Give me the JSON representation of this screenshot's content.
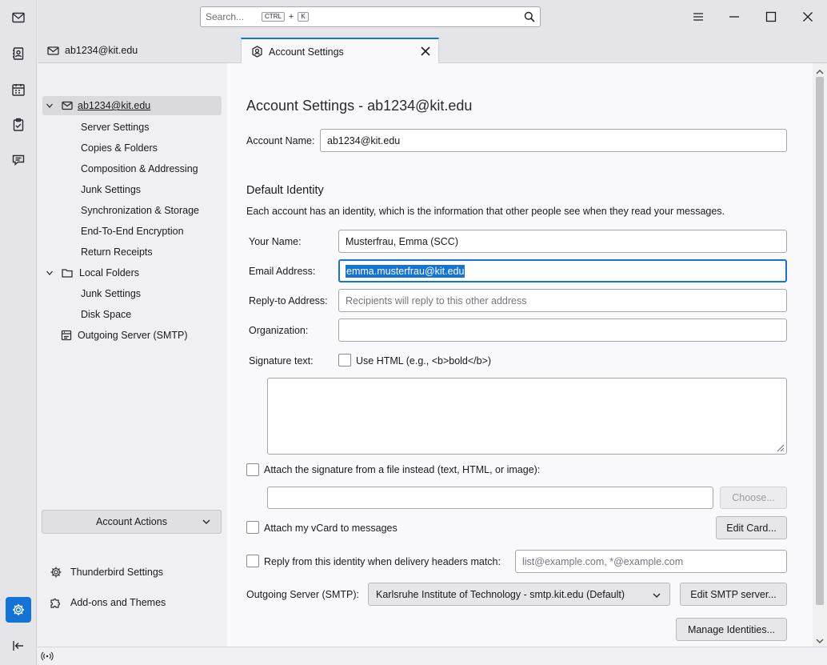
{
  "search": {
    "placeholder": "Search...",
    "shortcut_mod": "CTRL",
    "shortcut_plus": "+",
    "shortcut_key": "K"
  },
  "tabs": [
    {
      "label": "ab1234@kit.edu"
    },
    {
      "label": "Account Settings"
    }
  ],
  "sidebar": {
    "account": "ab1234@kit.edu",
    "account_children": [
      "Server Settings",
      "Copies & Folders",
      "Composition & Addressing",
      "Junk Settings",
      "Synchronization & Storage",
      "End-To-End Encryption",
      "Return Receipts"
    ],
    "local_folders": "Local Folders",
    "local_children": [
      "Junk Settings",
      "Disk Space"
    ],
    "outgoing": "Outgoing Server (SMTP)",
    "account_actions": "Account Actions",
    "thunderbird_settings": "Thunderbird Settings",
    "addons": "Add-ons and Themes"
  },
  "main": {
    "title": "Account Settings - ab1234@kit.edu",
    "account_name_label": "Account Name:",
    "account_name_value": "ab1234@kit.edu",
    "default_identity_heading": "Default Identity",
    "identity_description": "Each account has an identity, which is the information that other people see when they read your messages.",
    "your_name_label": "Your Name:",
    "your_name_value": "Musterfrau, Emma (SCC)",
    "email_label": "Email Address:",
    "email_value": "emma.musterfrau@kit.edu",
    "reply_to_label": "Reply-to Address:",
    "reply_to_placeholder": "Recipients will reply to this other address",
    "organization_label": "Organization:",
    "organization_value": "",
    "signature_label": "Signature text:",
    "use_html_label": "Use HTML (e.g., <b>bold</b>)",
    "signature_value": "",
    "attach_signature_label": "Attach the signature from a file instead (text, HTML, or image):",
    "signature_file_value": "",
    "choose_button": "Choose...",
    "attach_vcard_label": "Attach my vCard to messages",
    "edit_card_button": "Edit Card...",
    "reply_from_identity_label": "Reply from this identity when delivery headers match:",
    "reply_from_placeholder": "list@example.com, *@example.com",
    "outgoing_server_label": "Outgoing Server (SMTP):",
    "outgoing_server_value": "Karlsruhe Institute of Technology - smtp.kit.edu (Default)",
    "edit_smtp_button": "Edit SMTP server...",
    "manage_identities_button": "Manage Identities..."
  },
  "colors": {
    "accent": "#1373d9"
  }
}
